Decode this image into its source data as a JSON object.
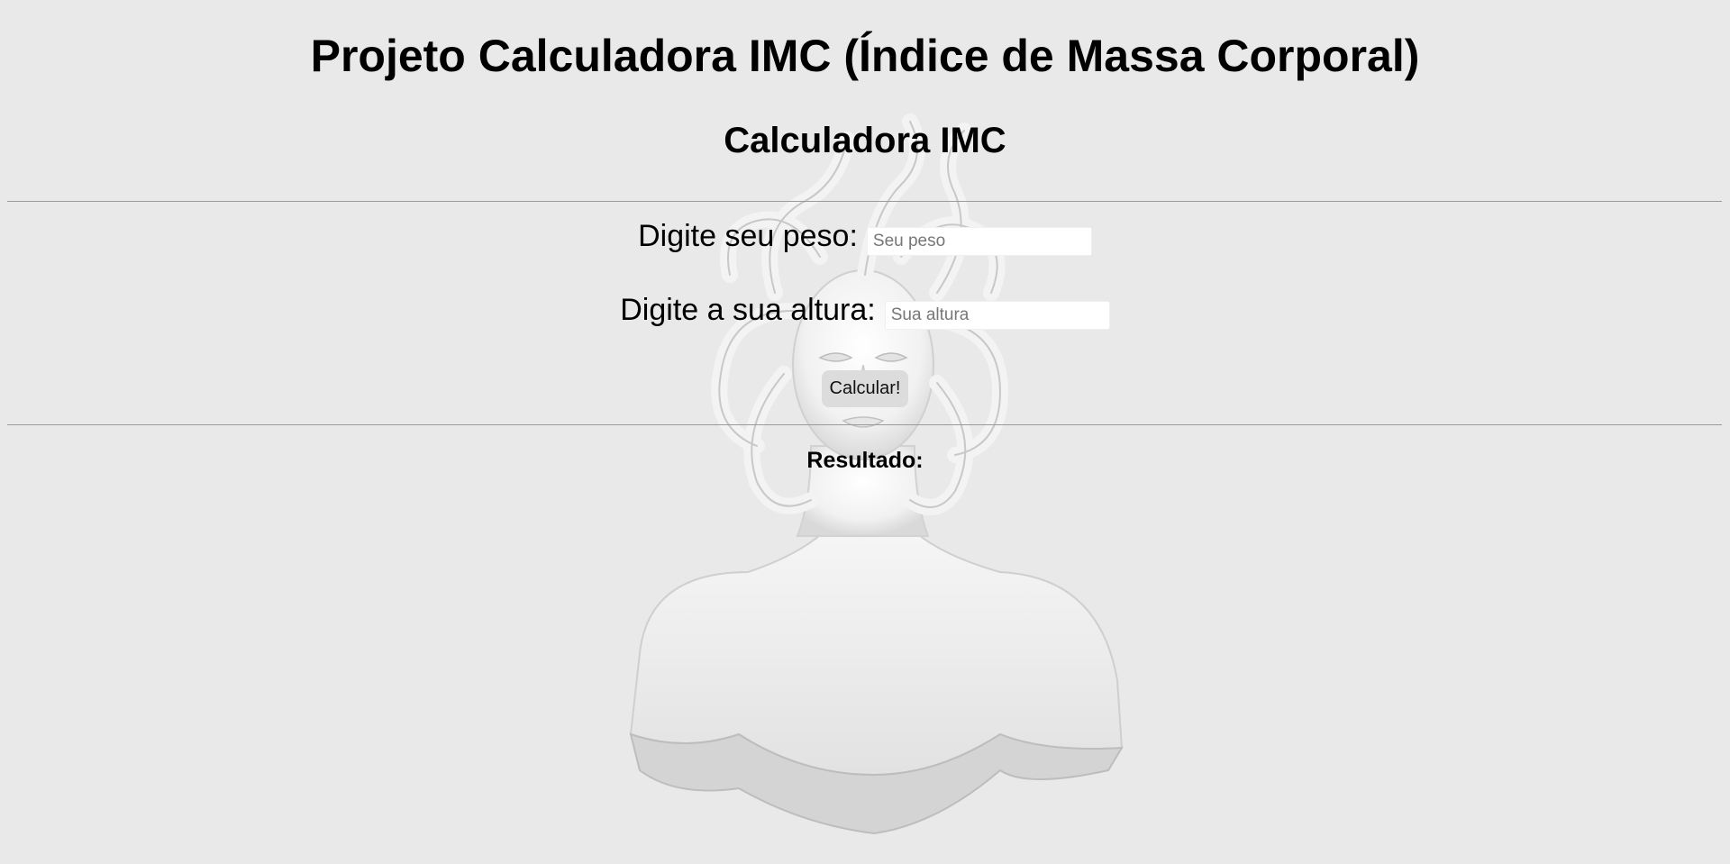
{
  "header": {
    "title": "Projeto Calculadora IMC (Índice de Massa Corporal)",
    "subtitle": "Calculadora IMC"
  },
  "form": {
    "peso_label": "Digite seu peso:",
    "peso_placeholder": "Seu peso",
    "peso_value": "",
    "altura_label": "Digite a sua altura:",
    "altura_placeholder": "Sua altura",
    "altura_value": "",
    "submit_label": "Calcular!"
  },
  "result": {
    "label": "Resultado:",
    "value": ""
  },
  "background": {
    "image": "medusa-bust-statue"
  },
  "colors": {
    "page_background": "#e9e9e9",
    "button_background": "#dcdcdc",
    "rule": "#9a9a9a"
  }
}
